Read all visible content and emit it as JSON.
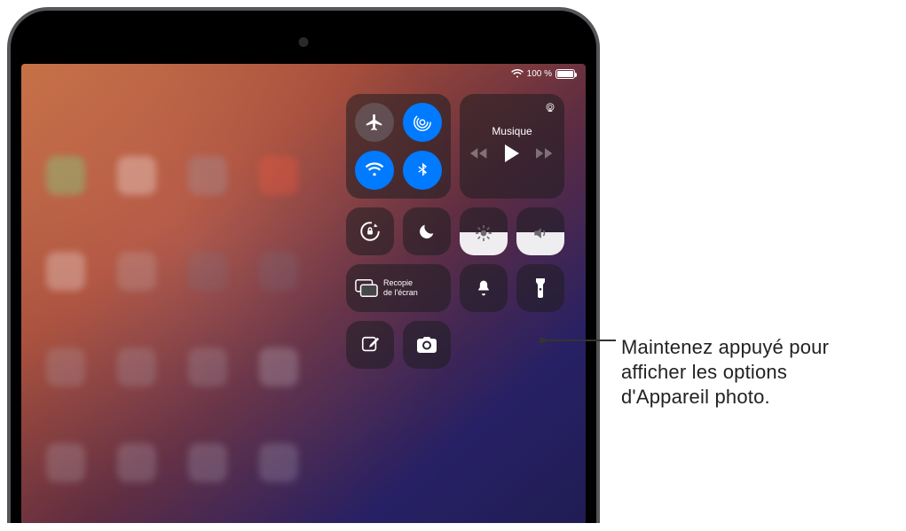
{
  "status": {
    "wifi_icon": "wifi",
    "battery_percent": "100 %",
    "battery_level": 1.0
  },
  "control_center": {
    "connectivity": {
      "airplane": {
        "active": false,
        "label": "Mode Avion"
      },
      "airdrop": {
        "active": true,
        "label": "AirDrop"
      },
      "wifi": {
        "active": true,
        "label": "Wi-Fi"
      },
      "bluetooth": {
        "active": true,
        "label": "Bluetooth"
      }
    },
    "media": {
      "title": "Musique",
      "airplay_icon": "airplay",
      "prev_icon": "rewind",
      "play_icon": "play",
      "next_icon": "forward"
    },
    "orientation_lock": {
      "label": "Verrouillage de l'orientation"
    },
    "do_not_disturb": {
      "label": "Ne pas déranger"
    },
    "screen_mirroring": {
      "label_line1": "Recopie",
      "label_line2": "de l'écran"
    },
    "brightness": {
      "level": 0.48,
      "icon": "sun"
    },
    "volume": {
      "level": 0.48,
      "icon": "speaker"
    },
    "silent": {
      "label": "Silence"
    },
    "flashlight": {
      "label": "Lampe torche"
    },
    "notes": {
      "label": "Notes"
    },
    "camera": {
      "label": "Appareil photo"
    }
  },
  "annotation": {
    "text": "Maintenez appuyé pour afficher les options d'Appareil photo."
  }
}
